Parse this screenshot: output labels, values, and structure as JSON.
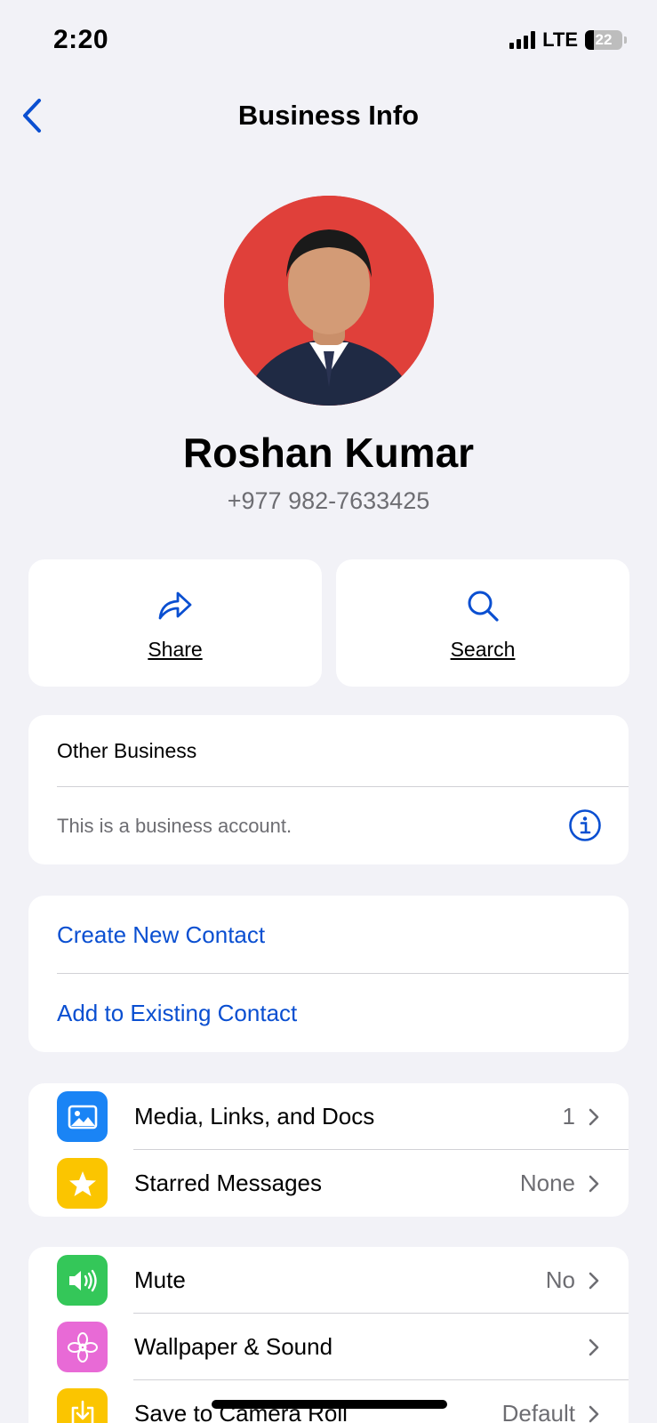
{
  "status_bar": {
    "time": "2:20",
    "network": "LTE",
    "battery": "22"
  },
  "nav": {
    "title": "Business Info"
  },
  "profile": {
    "name": "Roshan Kumar",
    "phone": "+977 982-7633425"
  },
  "actions": [
    {
      "label": "Share",
      "icon": "share-arrow-icon"
    },
    {
      "label": "Search",
      "icon": "search-icon"
    }
  ],
  "business": {
    "category": "Other Business",
    "description": "This is a business account.",
    "info_icon": "info-icon"
  },
  "contact_actions": [
    "Create New Contact",
    "Add to Existing Contact"
  ],
  "list_section_1": [
    {
      "label": "Media, Links, and Docs",
      "value": "1",
      "icon": "photo-icon",
      "color": "#1a84f5"
    },
    {
      "label": "Starred Messages",
      "value": "None",
      "icon": "star-icon",
      "color": "#fbc500"
    }
  ],
  "list_section_2": [
    {
      "label": "Mute",
      "value": "No",
      "icon": "speaker-icon",
      "color": "#34c759"
    },
    {
      "label": "Wallpaper & Sound",
      "value": "",
      "icon": "flower-icon",
      "color": "#e86ad6"
    },
    {
      "label": "Save to Camera Roll",
      "value": "Default",
      "icon": "save-download-icon",
      "color": "#fbc500"
    }
  ],
  "colors": {
    "accent": "#0a4fd1",
    "background": "#f2f2f7",
    "avatar_bg": "#e0403a"
  }
}
